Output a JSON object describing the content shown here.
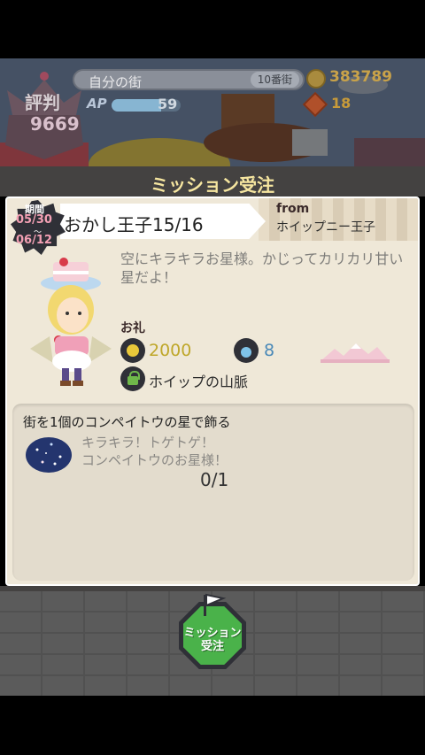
{
  "hud": {
    "reputation_label": "評判",
    "reputation_value": "9669",
    "town_name": "自分の街",
    "town_rank": "10番街",
    "ap_label": "AP",
    "ap_value": "59",
    "ap_fill_fraction": 0.72,
    "coins": "383789",
    "gems": "18"
  },
  "panel": {
    "title": "ミッション受注",
    "period": {
      "label": "期間",
      "start": "05/30",
      "separator": "〜",
      "end": "06/12"
    },
    "mission_name": "おかし王子15/16",
    "from_label": "from",
    "from_name": "ホイップニー王子",
    "description": "空にキラキラお星様。かじってカリカリ甘い星だよ！",
    "reward": {
      "label": "お礼",
      "coin_amount": "2000",
      "potion_amount": "8",
      "unlock_text": "ホイップの山脈"
    },
    "objective": {
      "title": "街を1個のコンペイトウの星で飾る",
      "flavor_line1": "キラキラ！トゲトゲ！",
      "flavor_line2": "コンペイトウのお星様！",
      "progress": "0/1"
    }
  },
  "button": {
    "accept_line1": "ミッション",
    "accept_line2": "受注"
  },
  "colors": {
    "title_text": "#f6e6a0",
    "panel_bg": "#efe8d8",
    "accept_green": "#4ab24a",
    "coin_gold": "#bfa72a",
    "potion_blue": "#4a89b8"
  }
}
